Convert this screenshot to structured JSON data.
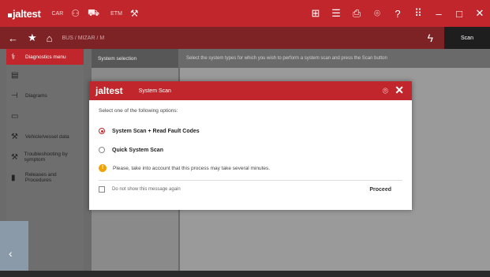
{
  "app": {
    "name": "jaltest",
    "mode1": "CAR",
    "mode2": "ETM"
  },
  "nav": {
    "crumb": "BUS / MIZAR / M",
    "scan_tab": "Scan"
  },
  "sidebar": {
    "items": [
      {
        "label": "Diagnostics menu",
        "icon": "diagnosis-icon"
      },
      {
        "label": "",
        "icon": "menu-icon"
      },
      {
        "label": "Diagrams",
        "icon": "diagram-icon"
      },
      {
        "label": "",
        "icon": "doc-icon"
      },
      {
        "label": "Vehicle/vessel data",
        "icon": "vehicle-icon"
      },
      {
        "label": "Troubleshooting by symptom",
        "icon": "troubleshooting-icon"
      },
      {
        "label": "Releases and Procedures",
        "icon": "book-icon"
      }
    ]
  },
  "panels": {
    "system_selection_header": "System selection",
    "main_header": "Select the system types for which you wish to perform a system scan and press the Scan button"
  },
  "modal": {
    "logo": "jaltest",
    "title": "System Scan",
    "instruction": "Select one of the following options:",
    "options": [
      {
        "label": "System Scan + Read Fault Codes",
        "selected": true
      },
      {
        "label": "Quick System Scan",
        "selected": false
      }
    ],
    "warning": "Please, take into account that this process may take several minutes.",
    "checkbox_label": "Do not show this message again",
    "proceed": "Proceed"
  },
  "colors": {
    "accent": "#c0262b",
    "warning": "#f2a100"
  }
}
